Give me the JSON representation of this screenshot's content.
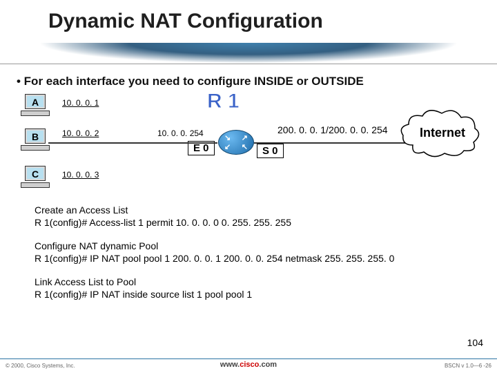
{
  "title": "Dynamic NAT Configuration",
  "bullet": "• For each interface you need to configure INSIDE or OUTSIDE",
  "hosts": {
    "a": {
      "label": "A",
      "ip": "10. 0. 0. 1"
    },
    "b": {
      "label": "B",
      "ip": "10. 0. 0. 2"
    },
    "c": {
      "label": "C",
      "ip": "10. 0. 0. 3"
    }
  },
  "router": {
    "name": "R 1",
    "inside_ip": "10. 0. 0. 254",
    "if_e0": "E 0",
    "if_s0": "S 0",
    "outside_ip": "200. 0. 0. 1/200. 0. 0. 254"
  },
  "cloud": {
    "label": "Internet"
  },
  "config1": {
    "header": "Create an Access List",
    "line": "R 1(config)# Access-list 1 permit 10. 0. 0. 0 0. 255. 255. 255"
  },
  "config2": {
    "header": "Configure NAT dynamic Pool",
    "line": "R 1(config)# IP NAT pool pool 1 200. 0. 0. 1 200. 0. 0. 254 netmask 255. 255. 255. 0"
  },
  "config3": {
    "header": "Link Access List to Pool",
    "line": "R 1(config)# IP NAT inside source list 1 pool pool 1"
  },
  "slide_number": "104",
  "footer": {
    "left": "© 2000, Cisco Systems, Inc.",
    "mid_www": "www.",
    "mid_brand": "cisco",
    "mid_com": ".com",
    "right": "BSCN v 1.0—6 -26"
  }
}
